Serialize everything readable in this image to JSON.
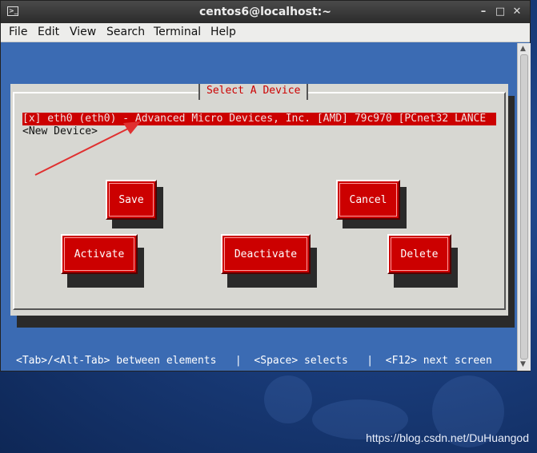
{
  "window": {
    "title": "centos6@localhost:~",
    "minimize_glyph": "–",
    "maximize_glyph": "□",
    "close_glyph": "✕"
  },
  "menu": [
    "File",
    "Edit",
    "View",
    "Search",
    "Terminal",
    "Help"
  ],
  "dialog": {
    "title": "Select A Device",
    "devices": [
      {
        "label": "[x] eth0 (eth0) - Advanced Micro Devices, Inc. [AMD] 79c970 [PCnet32 LANCE",
        "selected": true
      },
      {
        "label": "<New Device>",
        "selected": false
      }
    ],
    "buttons": {
      "save": "Save",
      "cancel": "Cancel",
      "activate": "Activate",
      "deactivate": "Deactivate",
      "delete": "Delete"
    }
  },
  "status_bar": "<Tab>/<Alt-Tab> between elements   |  <Space> selects   |  <F12> next screen",
  "watermark": "https://blog.csdn.net/DuHuangod",
  "colors": {
    "terminal_bg": "#3b6bb3",
    "dialog_bg": "#d7d7d2",
    "accent_red": "#cc0000",
    "annotation_arrow": "#e03030"
  }
}
